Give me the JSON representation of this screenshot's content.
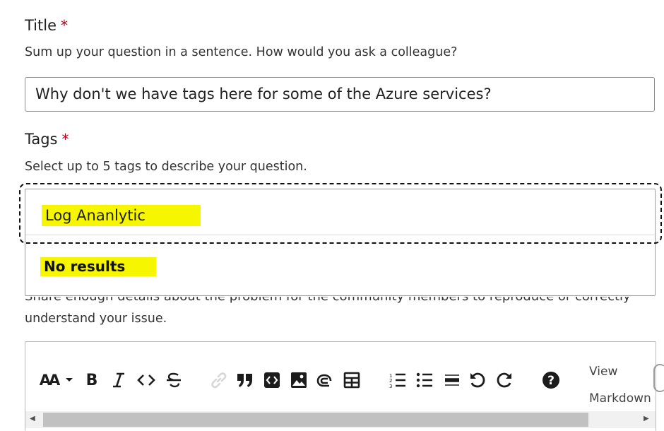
{
  "title_field": {
    "label": "Title",
    "required": "*",
    "help": "Sum up your question in a sentence. How would you ask a colleague?",
    "value": "Why don't we have tags here for some of the Azure services?"
  },
  "tags_field": {
    "label": "Tags",
    "required": "*",
    "help": "Select up to 5 tags to describe your question.",
    "input_value": "Log Ananlytic",
    "dropdown_message": "No results",
    "highlight_color": "#f6f600"
  },
  "body_field": {
    "help_line1": "Share enough details about the problem for the community members to reproduce or correctly",
    "help_line2": "understand your issue."
  },
  "toolbar": {
    "font_size_label": "AA",
    "buttons": [
      "font-size-icon",
      "chevron-down-icon",
      "bold-icon",
      "italic-icon",
      "code-icon",
      "strikethrough-icon",
      "link-icon",
      "quote-icon",
      "code-block-icon",
      "image-icon",
      "attachment-icon",
      "table-icon",
      "numbered-list-icon",
      "bulleted-list-icon",
      "horizontal-rule-icon",
      "undo-icon",
      "redo-icon",
      "help-icon"
    ],
    "view_markdown_line1": "View",
    "view_markdown_line2": "Markdown"
  }
}
